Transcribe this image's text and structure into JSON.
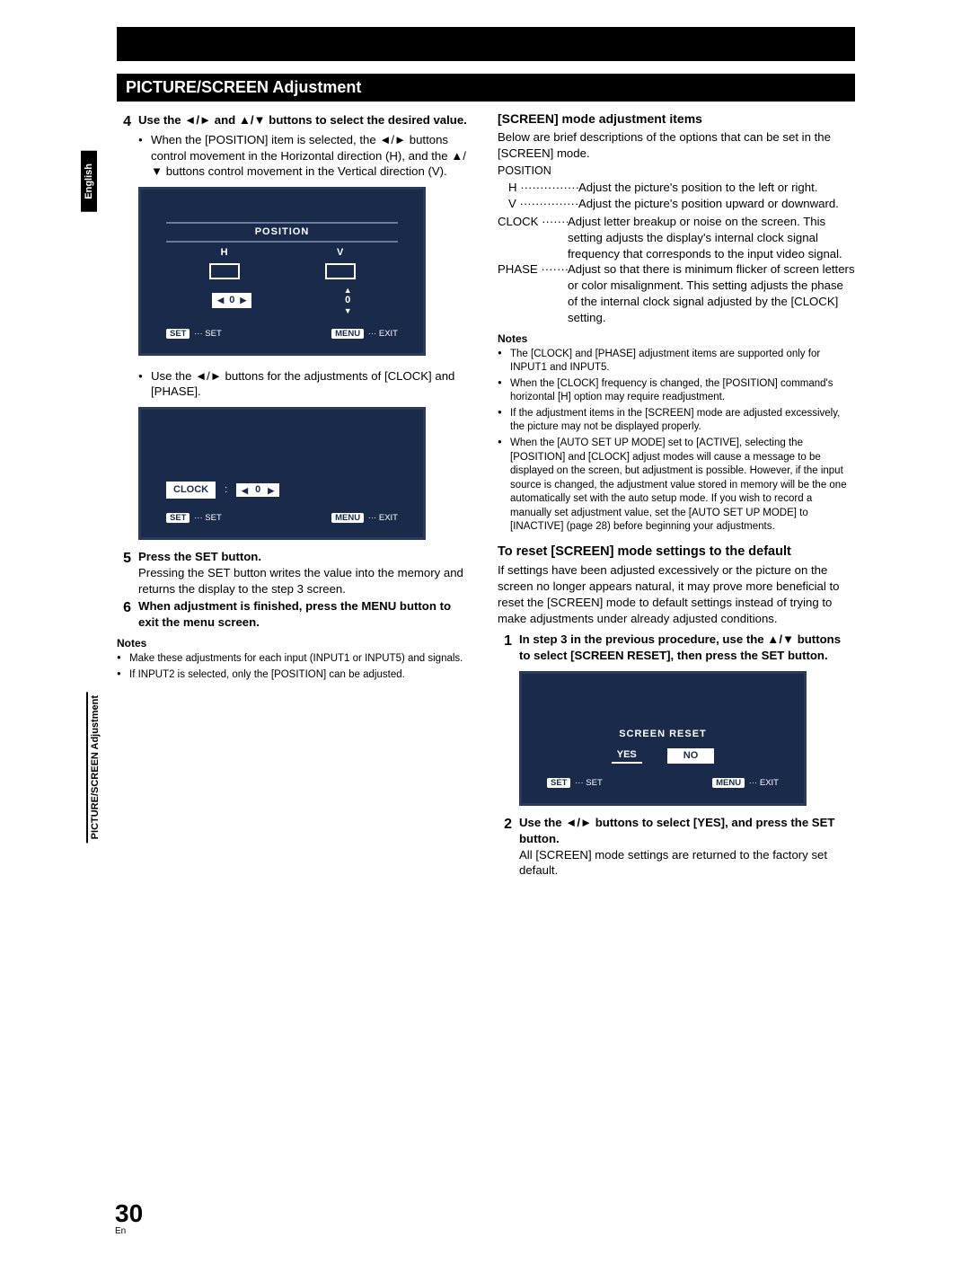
{
  "side": {
    "lang": "English",
    "section": "PICTURE/SCREEN Adjustment"
  },
  "title": "PICTURE/SCREEN Adjustment",
  "page": {
    "num": "30",
    "lang": "En"
  },
  "left": {
    "step4": {
      "num": "4",
      "title": "Use the ◄/► and ▲/▼ buttons to select the desired value.",
      "b1": "When the [POSITION] item is selected, the ◄/► buttons control movement in the Horizontal direction (H), and the ▲/▼ buttons control movement in the Vertical direction (V)."
    },
    "osdPos": {
      "heading": "POSITION",
      "h": "H",
      "v": "V",
      "hval": "0",
      "vval": "0",
      "setBtn": "SET",
      "setLbl": "SET",
      "menuBtn": "MENU",
      "exitLbl": "EXIT"
    },
    "afterPos": {
      "b1": "Use the ◄/► buttons for the adjustments of [CLOCK] and [PHASE]."
    },
    "osdClock": {
      "label": "CLOCK",
      "colon": ":",
      "val": "0",
      "setBtn": "SET",
      "setLbl": "SET",
      "menuBtn": "MENU",
      "exitLbl": "EXIT"
    },
    "step5": {
      "num": "5",
      "title": "Press the SET button.",
      "body": "Pressing the SET button writes the value into the memory and returns the display to the step 3 screen."
    },
    "step6": {
      "num": "6",
      "title": "When adjustment is finished, press the MENU button to exit the menu screen."
    },
    "notes": {
      "hd": "Notes",
      "n1": "Make these adjustments for each input (INPUT1 or INPUT5) and signals.",
      "n2": "If INPUT2 is selected, only the [POSITION] can be adjusted."
    }
  },
  "right": {
    "hd": "[SCREEN] mode adjustment items",
    "intro": "Below are brief descriptions of the options that can be set in the [SCREEN] mode.",
    "posLabel": "POSITION",
    "defs": {
      "h": {
        "term": "H",
        "desc": "Adjust the picture's position to the left or right."
      },
      "v": {
        "term": "V",
        "desc": "Adjust the picture's position upward or downward."
      },
      "clock": {
        "term": "CLOCK",
        "desc": "Adjust letter breakup or noise on the screen. This setting adjusts the display's internal clock signal frequency that corresponds to the input video signal."
      },
      "phase": {
        "term": "PHASE",
        "desc": "Adjust so that there is minimum flicker of screen letters or color misalignment. This setting adjusts the phase of the internal clock signal adjusted by the [CLOCK] setting."
      }
    },
    "notes": {
      "hd": "Notes",
      "n1": "The [CLOCK] and [PHASE] adjustment items are supported only for INPUT1 and INPUT5.",
      "n2": "When the [CLOCK] frequency is changed, the [POSITION] command's horizontal [H] option may require readjustment.",
      "n3": "If the adjustment items in the [SCREEN] mode are adjusted excessively, the picture may not be displayed properly.",
      "n4": "When the [AUTO SET UP MODE] set to [ACTIVE], selecting the [POSITION] and [CLOCK] adjust modes will cause a message to be displayed on the screen, but adjustment is possible. However, if the input source is changed, the adjustment value stored in memory will be the one automatically set with the auto setup mode. If you wish to record a manually set adjustment value, set the [AUTO SET UP MODE] to [INACTIVE] (page 28) before beginning your adjustments."
    },
    "reset": {
      "hd": "To reset [SCREEN] mode settings to the default",
      "body": "If settings have been adjusted excessively or the picture on the screen no longer appears natural, it may prove more beneficial to reset the [SCREEN] mode to default settings instead of trying to make adjustments under already adjusted conditions.",
      "s1": {
        "num": "1",
        "title": "In step 3 in the previous procedure, use the ▲/▼ buttons to select [SCREEN RESET], then press the SET button."
      },
      "osd": {
        "heading": "SCREEN RESET",
        "yes": "YES",
        "no": "NO",
        "setBtn": "SET",
        "setLbl": "SET",
        "menuBtn": "MENU",
        "exitLbl": "EXIT"
      },
      "s2": {
        "num": "2",
        "title": "Use the ◄/► buttons to select [YES], and press the SET button.",
        "body": "All [SCREEN] mode settings are returned to the factory set default."
      }
    }
  }
}
